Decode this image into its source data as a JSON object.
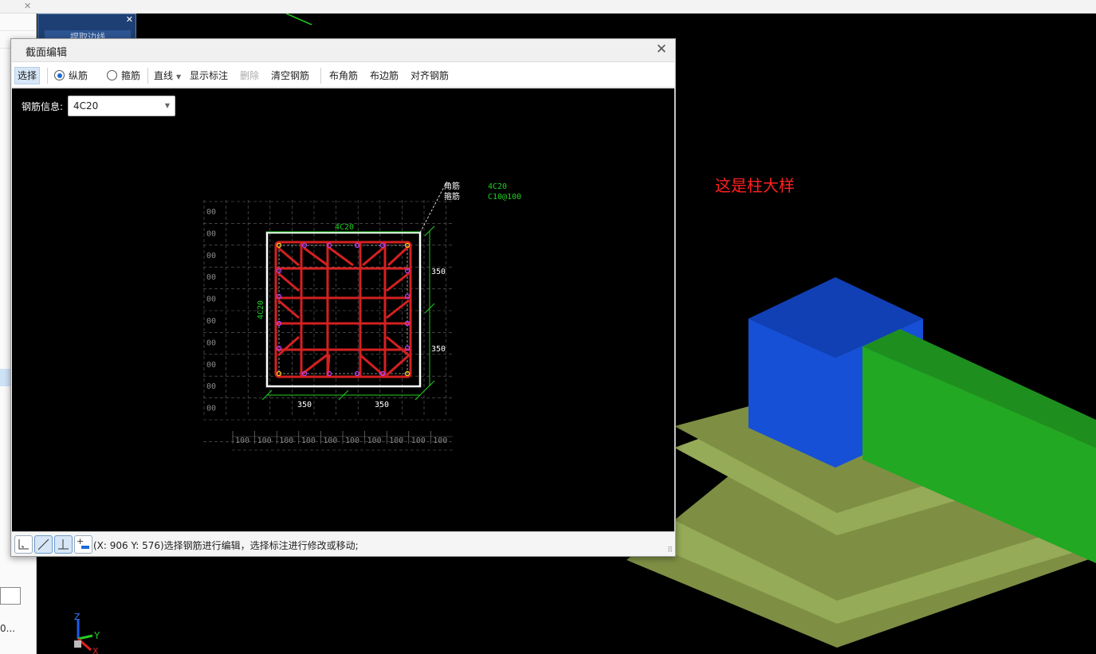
{
  "host": {
    "left_panel_text": "0...",
    "blue_panel_button": "提取边线",
    "viewport_label": "这是柱大样",
    "axis_x": "X",
    "axis_y": "Y",
    "axis_z": "Z"
  },
  "dialog": {
    "title": "截面编辑",
    "toolbar": {
      "select": "选择",
      "longitudinal": "纵筋",
      "stirrup": "箍筋",
      "line_type": "直线",
      "show_annotation": "显示标注",
      "delete": "删除",
      "clear_rebar": "清空钢筋",
      "corner_rebar": "布角筋",
      "edge_rebar": "布边筋",
      "align_rebar": "对齐钢筋"
    },
    "rebar_info_label": "钢筋信息:",
    "rebar_info_value": "4C20",
    "status_text": "(X: 906 Y: 576)选择钢筋进行编辑，选择标注进行修改或移动;",
    "colors": {
      "rebar": "#d42020",
      "dimension": "#1fd11f",
      "section_outline": "#ffffff",
      "grid": "#666666"
    }
  },
  "section": {
    "legend": [
      {
        "name": "角筋",
        "value": "4C20"
      },
      {
        "name": "箍筋",
        "value": "C10@100"
      }
    ],
    "top_label": "4C20",
    "left_label": "4C20",
    "dim_right": [
      "350",
      "350"
    ],
    "dim_bottom": [
      "350",
      "350"
    ],
    "grid_left_labels": [
      "00",
      "00",
      "00",
      "00",
      "00",
      "00",
      "00",
      "00",
      "00",
      "00"
    ],
    "grid_bottom_labels": [
      "100",
      "100",
      "100",
      "100",
      "100",
      "100",
      "100",
      "100",
      "100",
      "100"
    ]
  }
}
